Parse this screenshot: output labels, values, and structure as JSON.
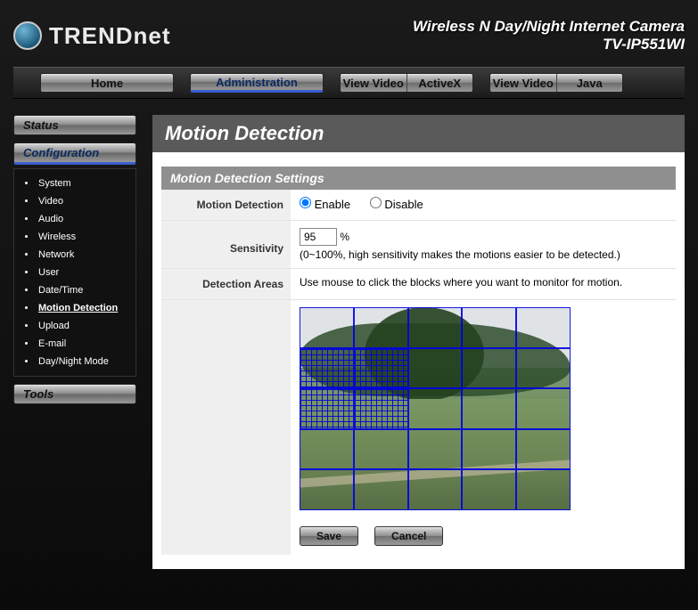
{
  "header": {
    "brand": "TRENDnet",
    "title": "Wireless N Day/Night Internet Camera",
    "model": "TV-IP551WI"
  },
  "nav": {
    "home": "Home",
    "admin": "Administration",
    "view_video": "View Video",
    "activex": "ActiveX",
    "java": "Java"
  },
  "side": {
    "status": "Status",
    "configuration": "Configuration",
    "tools": "Tools",
    "items": [
      "System",
      "Video",
      "Audio",
      "Wireless",
      "Network",
      "User",
      "Date/Time",
      "Motion Detection",
      "Upload",
      "E-mail",
      "Day/Night Mode"
    ]
  },
  "main": {
    "title": "Motion Detection",
    "settings_head": "Motion Detection Settings",
    "labels": {
      "motion_detection": "Motion Detection",
      "sensitivity": "Sensitivity",
      "detection_areas": "Detection Areas"
    },
    "enable": "Enable",
    "disable": "Disable",
    "motion_enabled": true,
    "sensitivity_value": "95",
    "pct": "%",
    "sensitivity_hint": "(0~100%, high sensitivity makes the motions easier to be detected.)",
    "areas_hint": "Use mouse to click the blocks where you want to monitor for motion.",
    "save": "Save",
    "cancel": "Cancel",
    "grid_selected": [
      5,
      6,
      10,
      11
    ]
  }
}
